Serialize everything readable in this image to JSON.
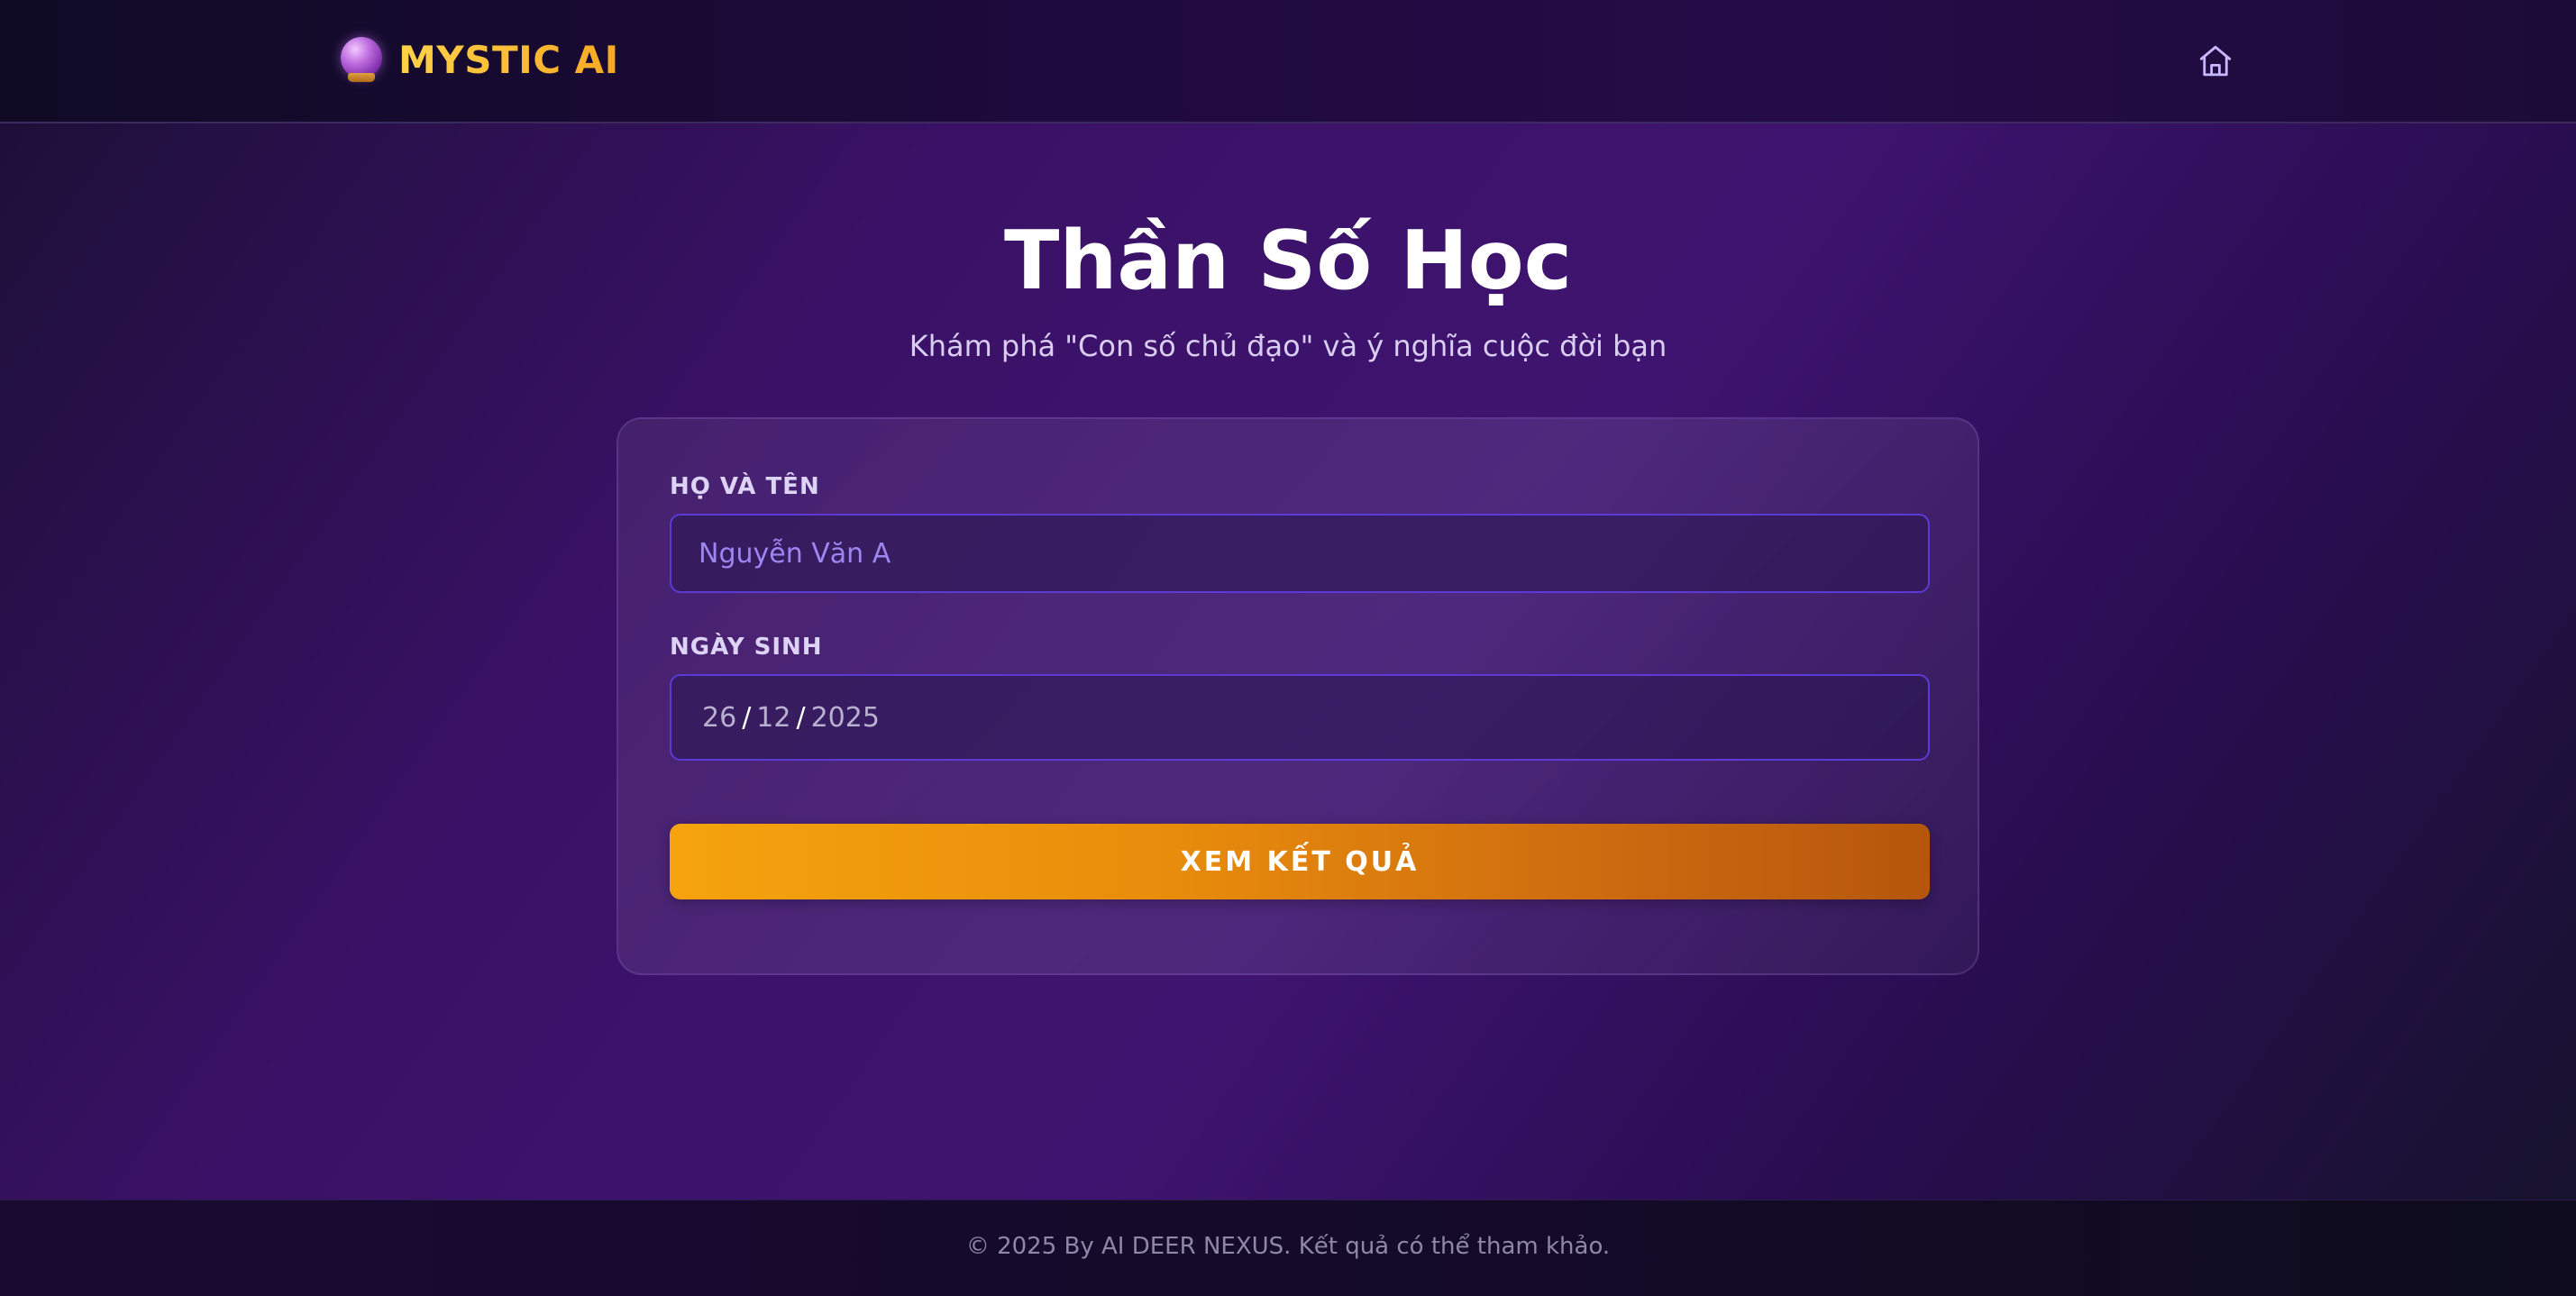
{
  "header": {
    "logo_text": "MYSTIC AI",
    "logo_icon": "crystal-ball-icon",
    "home_icon": "home-icon"
  },
  "main": {
    "title": "Thần Số Học",
    "subtitle": "Khám phá \"Con số chủ đạo\" và ý nghĩa cuộc đời bạn"
  },
  "form": {
    "name_label": "HỌ VÀ TÊN",
    "name_placeholder": "Nguyễn Văn A",
    "name_value": "",
    "dob_label": "NGÀY SINH",
    "dob_day": "26",
    "dob_month": "12",
    "dob_year": "2025",
    "dob_separator": "/",
    "submit_label": "XEM KẾT QUẢ"
  },
  "footer": {
    "text": "© 2025 By AI DEER NEXUS. Kết quả có thể tham khảo."
  },
  "colors": {
    "accent": "#f5a30e",
    "logo": "#fbc330",
    "input_border": "#5b3ad6"
  }
}
